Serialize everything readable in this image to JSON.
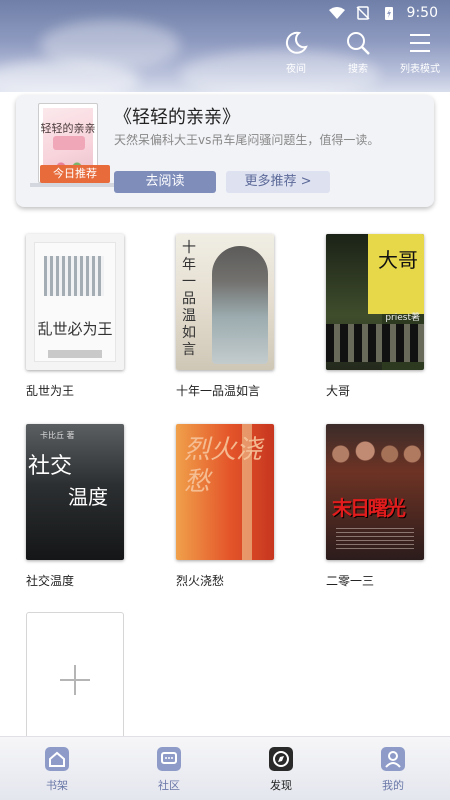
{
  "status_bar": {
    "time": "9:50"
  },
  "header": {
    "actions": [
      {
        "label": "夜间",
        "icon": "moon-icon"
      },
      {
        "label": "搜索",
        "icon": "search-icon"
      },
      {
        "label": "列表模式",
        "icon": "list-icon"
      }
    ]
  },
  "recommend": {
    "cover_title": "轻轻的亲亲",
    "badge": "今日推荐",
    "title": "《轻轻的亲亲》",
    "description": "天然呆偏科大王vs吊车尾闷骚问题生，值得一读。",
    "read_button": "去阅读",
    "more_button": "更多推荐 >"
  },
  "books": [
    {
      "name": "乱世为王",
      "cover_text": "乱世必为王"
    },
    {
      "name": "十年一品温如言",
      "cover_text": "十年一品温如言"
    },
    {
      "name": "大哥",
      "cover_text": "大哥",
      "cover_tag": "priest著"
    },
    {
      "name": "社交温度",
      "cover_text": "社交",
      "cover_text2": "温度"
    },
    {
      "name": "烈火浇愁",
      "cover_text": "烈火浇愁"
    },
    {
      "name": "二零一三",
      "cover_text": "末日曙光"
    }
  ],
  "add_book": {
    "icon": "plus-icon"
  },
  "bottom_nav": [
    {
      "label": "书架",
      "icon": "bookshelf-icon"
    },
    {
      "label": "社区",
      "icon": "community-icon"
    },
    {
      "label": "发现",
      "icon": "compass-icon"
    },
    {
      "label": "我的",
      "icon": "profile-icon"
    }
  ],
  "colors": {
    "accent": "#7f8dbb",
    "badge": "#e76b3b",
    "nav_label": "#6a78a8"
  }
}
